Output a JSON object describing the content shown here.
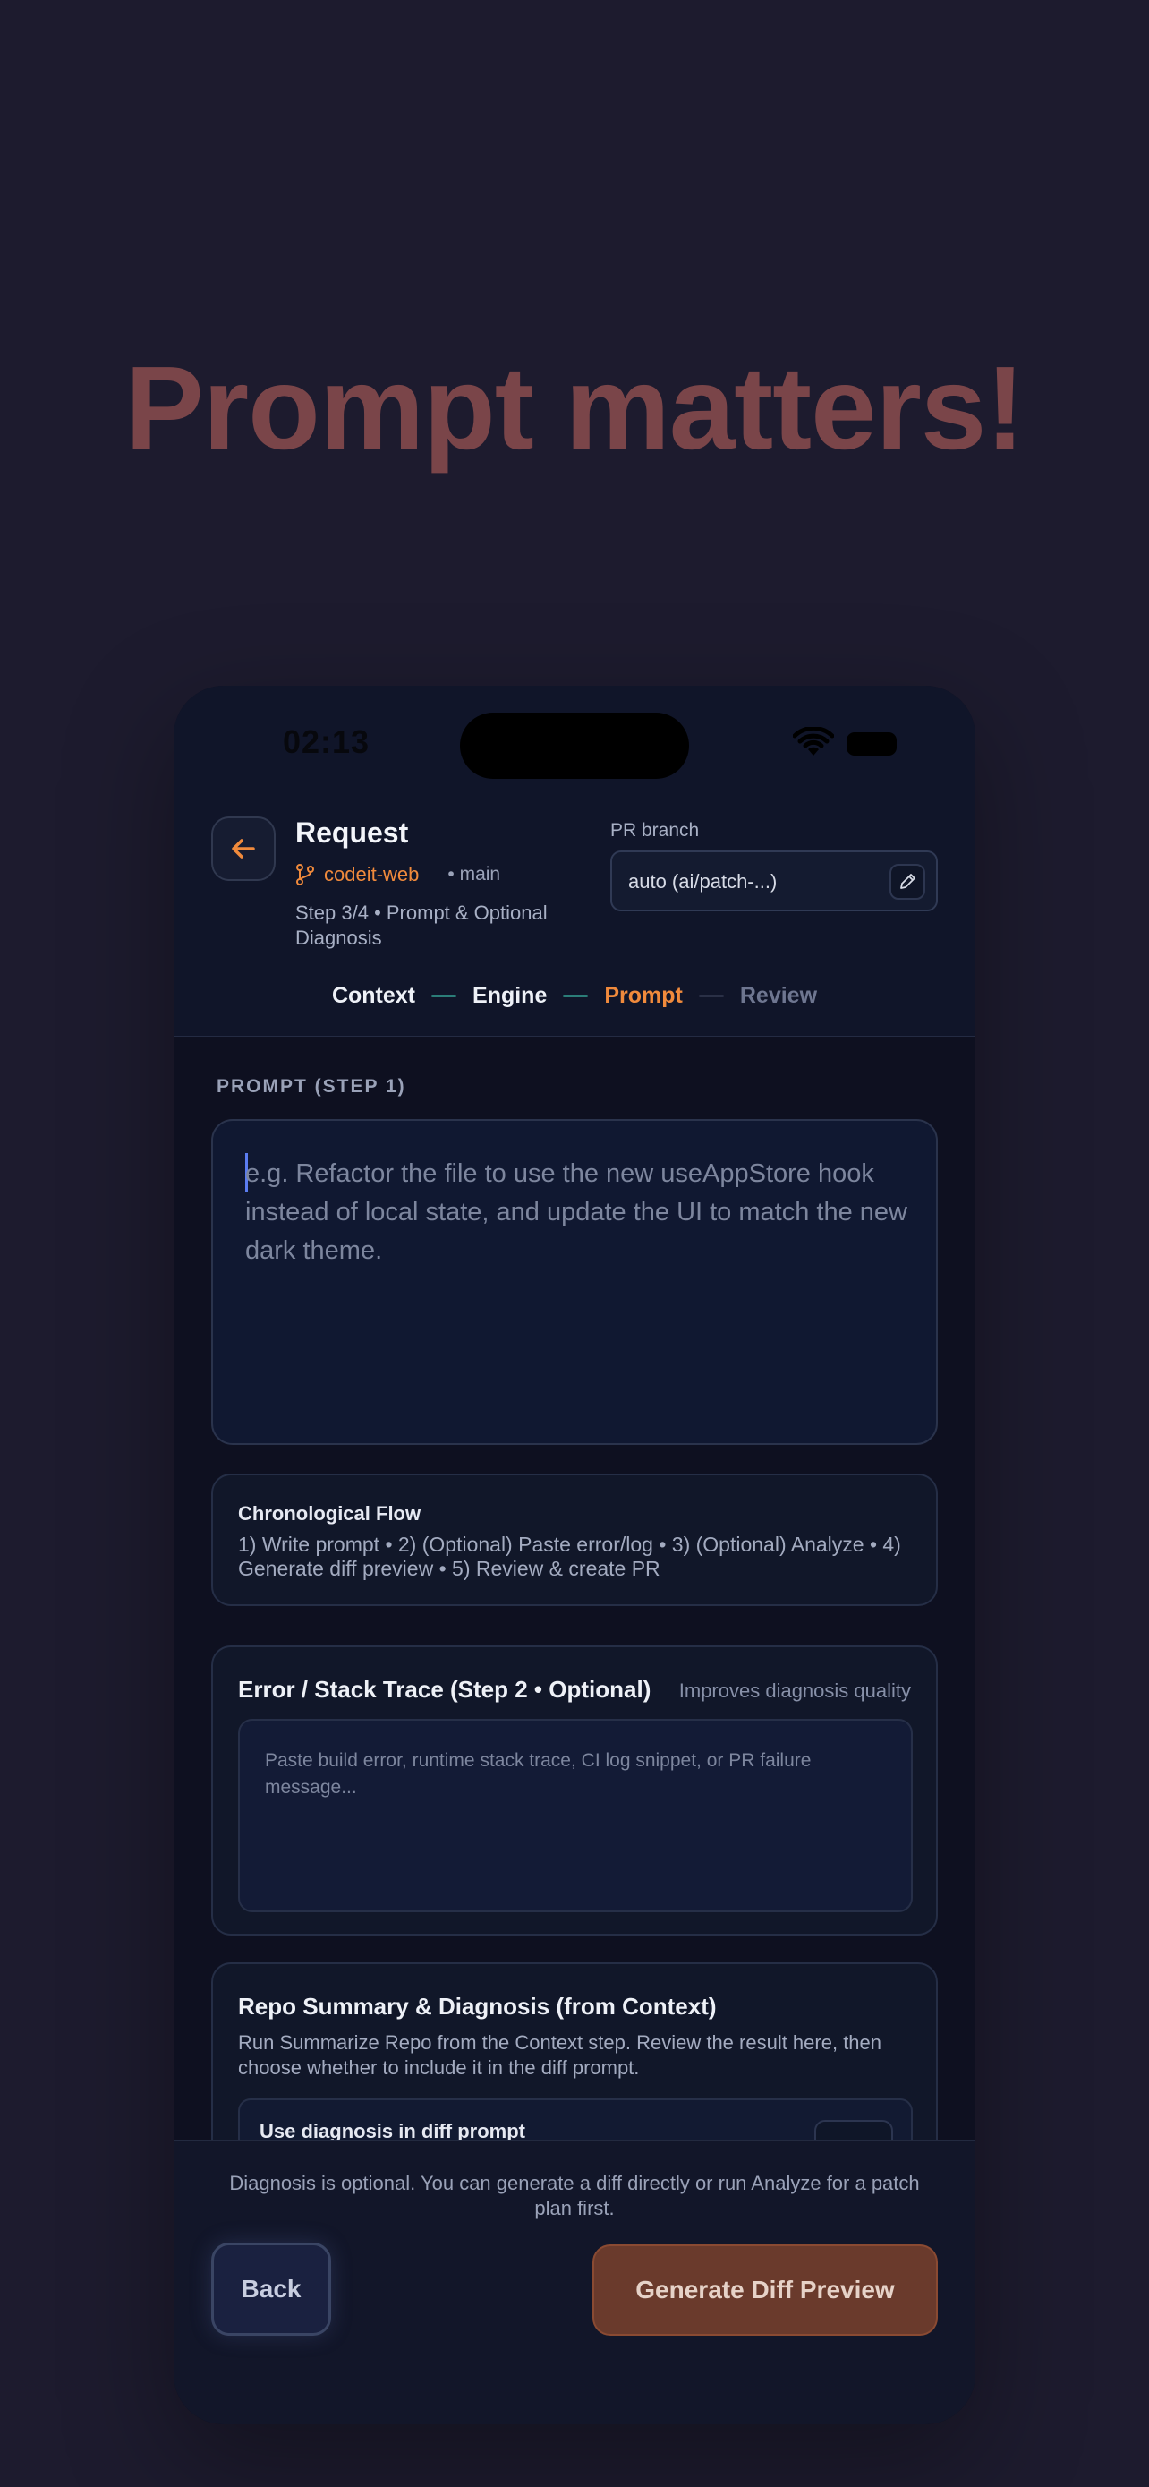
{
  "headline": "Prompt matters!",
  "status_bar": {
    "time": "02:13"
  },
  "header": {
    "title": "Request",
    "repo_name": "codeit-web",
    "branch": "• main",
    "step_text": "Step 3/4 • Prompt & Optional Diagnosis",
    "pr_branch_label": "PR branch",
    "pr_branch_value": "auto (ai/patch-...)"
  },
  "stepper": {
    "steps": [
      "Context",
      "Engine",
      "Prompt",
      "Review"
    ],
    "active": "Prompt"
  },
  "prompt": {
    "section_label": "PROMPT (STEP 1)",
    "placeholder": "e.g. Refactor the file to use the new useAppStore hook instead of local state, and update the UI to match the new dark theme."
  },
  "flow": {
    "title": "Chronological Flow",
    "text": "1) Write prompt  •  2) (Optional) Paste error/log  •  3) (Optional) Analyze  •  4) Generate diff preview  •  5) Review & create PR"
  },
  "error_trace": {
    "title": "Error / Stack Trace (Step 2 • Optional)",
    "hint": "Improves diagnosis quality",
    "placeholder": "Paste build error, runtime stack trace, CI log snippet, or PR failure message..."
  },
  "repo_summary": {
    "title": "Repo Summary & Diagnosis (from Context)",
    "text": "Run Summarize Repo from the Context step. Review the result here, then choose whether to include it in the diff prompt.",
    "toggle_label": "Use diagnosis in diff prompt"
  },
  "footer": {
    "note": "Diagnosis is optional. You can generate a diff directly or run Analyze for a patch plan first.",
    "back_label": "Back",
    "generate_label": "Generate Diff Preview"
  },
  "colors": {
    "accent": "#f08a3c",
    "background": "#1d1b2e",
    "headline": "#7a4549"
  }
}
